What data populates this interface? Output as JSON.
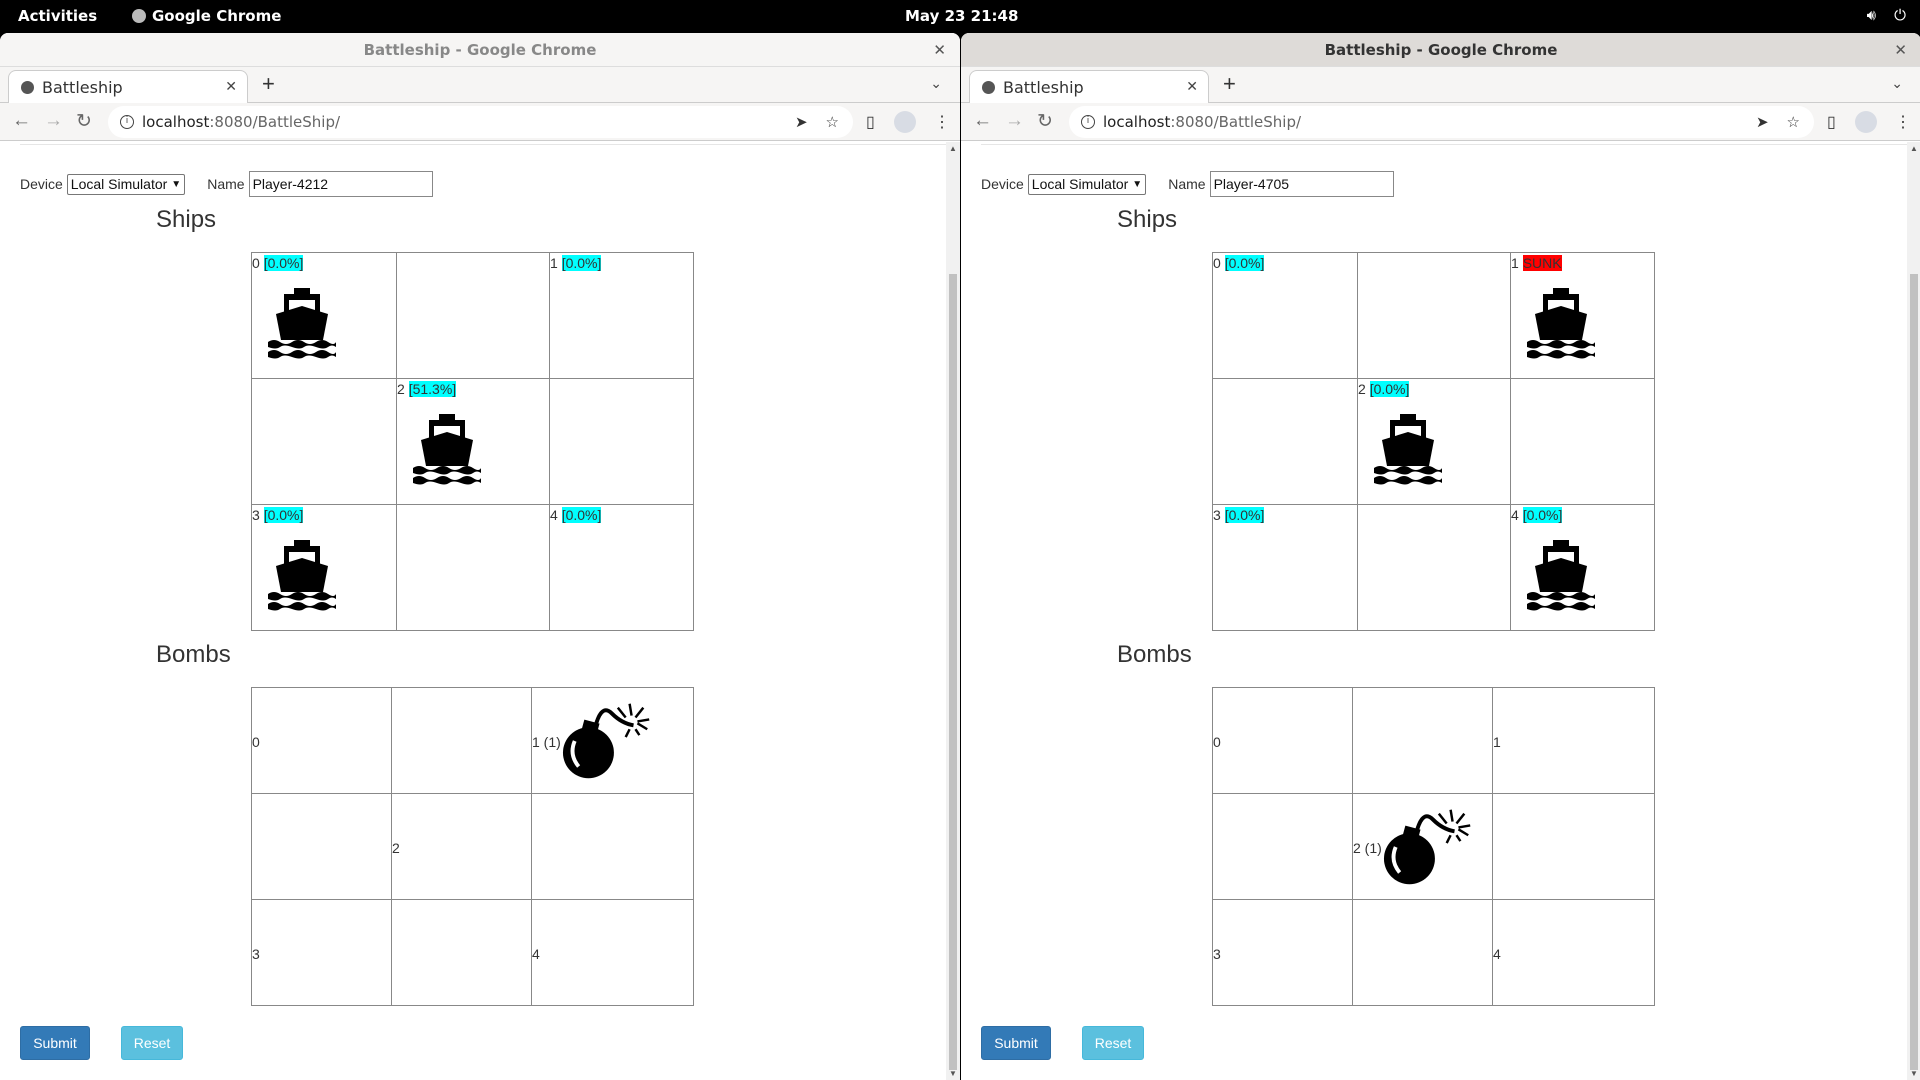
{
  "system": {
    "activities": "Activities",
    "app": "Google Chrome",
    "clock": "May 23  21:48"
  },
  "windows": [
    {
      "title": "Battleship - Google Chrome",
      "tab": "Battleship",
      "url_host": "localhost",
      "url_path": ":8080/BattleShip/",
      "device_label": "Device",
      "device_value": "Local Simulator",
      "name_label": "Name",
      "name_value": "Player-4212",
      "ships_heading": "Ships",
      "bombs_heading": "Bombs",
      "ships": [
        {
          "label": "0",
          "status": "[0.0%]",
          "ship": true
        },
        {},
        {
          "label": "1",
          "status": "[0.0%]",
          "ship": false
        },
        {},
        {
          "label": "2",
          "status": "[51.3%]",
          "ship": true
        },
        {},
        {
          "label": "3",
          "status": "[0.0%]",
          "ship": true
        },
        {},
        {
          "label": "4",
          "status": "[0.0%]",
          "ship": false
        }
      ],
      "bombs": [
        {
          "label": "0",
          "bomb": false
        },
        {},
        {
          "label": "1 (1)",
          "bomb": true
        },
        {},
        {
          "label": "2",
          "bomb": false
        },
        {},
        {
          "label": "3",
          "bomb": false
        },
        {},
        {
          "label": "4",
          "bomb": false
        }
      ],
      "submit": "Submit",
      "reset": "Reset"
    },
    {
      "title": "Battleship - Google Chrome",
      "tab": "Battleship",
      "url_host": "localhost",
      "url_path": ":8080/BattleShip/",
      "device_label": "Device",
      "device_value": "Local Simulator",
      "name_label": "Name",
      "name_value": "Player-4705",
      "ships_heading": "Ships",
      "bombs_heading": "Bombs",
      "ships": [
        {
          "label": "0",
          "status": "[0.0%]",
          "ship": false
        },
        {},
        {
          "label": "1",
          "status": "SUNK",
          "sunk": true,
          "ship": true
        },
        {},
        {
          "label": "2",
          "status": "[0.0%]",
          "ship": true
        },
        {},
        {
          "label": "3",
          "status": "[0.0%]",
          "ship": false
        },
        {},
        {
          "label": "4",
          "status": "[0.0%]",
          "ship": true
        }
      ],
      "bombs": [
        {
          "label": "0",
          "bomb": false
        },
        {},
        {
          "label": "1",
          "bomb": false
        },
        {},
        {
          "label": "2 (1)",
          "bomb": true
        },
        {},
        {
          "label": "3",
          "bomb": false
        },
        {},
        {
          "label": "4",
          "bomb": false
        }
      ],
      "submit": "Submit",
      "reset": "Reset"
    }
  ],
  "colors": {
    "status": "#00ffff",
    "sunk": "#ff0000",
    "submit": "#337ab7",
    "reset": "#5bc0de"
  }
}
